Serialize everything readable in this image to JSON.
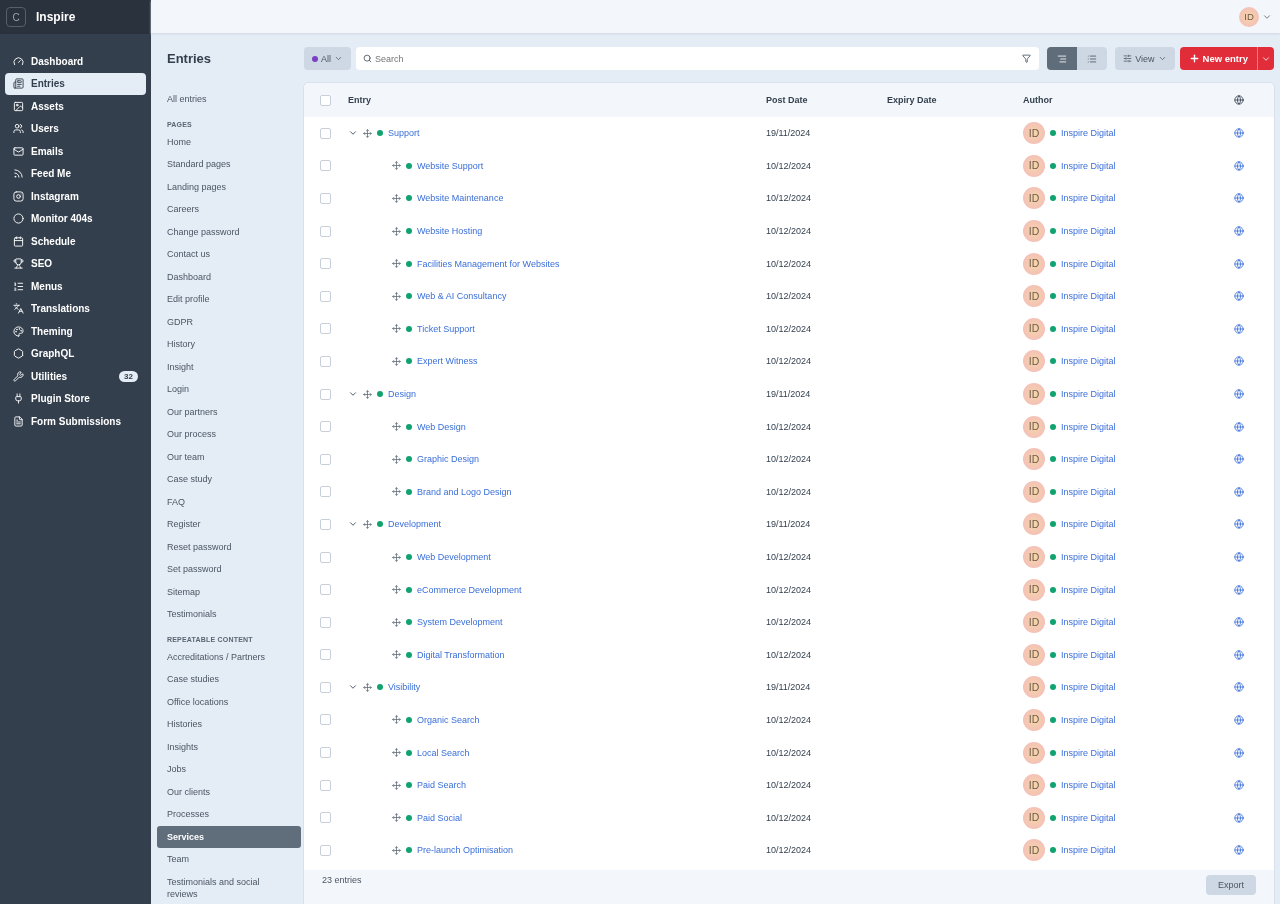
{
  "app": {
    "logo": "C",
    "name": "Inspire"
  },
  "nav": [
    {
      "label": "Dashboard",
      "selected": false
    },
    {
      "label": "Entries",
      "selected": true
    },
    {
      "label": "Assets",
      "selected": false
    },
    {
      "label": "Users",
      "selected": false
    },
    {
      "label": "Emails",
      "selected": false
    },
    {
      "label": "Feed Me",
      "selected": false
    },
    {
      "label": "Instagram",
      "selected": false
    },
    {
      "label": "Monitor 404s",
      "selected": false
    },
    {
      "label": "Schedule",
      "selected": false
    },
    {
      "label": "SEO",
      "selected": false
    },
    {
      "label": "Menus",
      "selected": false
    },
    {
      "label": "Translations",
      "selected": false
    },
    {
      "label": "Theming",
      "selected": false
    },
    {
      "label": "GraphQL",
      "selected": false
    },
    {
      "label": "Utilities",
      "selected": false,
      "badge": "32"
    },
    {
      "label": "Plugin Store",
      "selected": false
    },
    {
      "label": "Form Submissions",
      "selected": false
    }
  ],
  "user_avatar": "ID",
  "sources": {
    "title": "Entries",
    "groups": [
      {
        "items": [
          {
            "label": "All entries",
            "selected": false
          }
        ]
      },
      {
        "heading": "PAGES",
        "items": [
          {
            "label": "Home",
            "selected": false
          },
          {
            "label": "Standard pages",
            "selected": false
          },
          {
            "label": "Landing pages",
            "selected": false
          },
          {
            "label": "Careers",
            "selected": false
          },
          {
            "label": "Change password",
            "selected": false
          },
          {
            "label": "Contact us",
            "selected": false
          },
          {
            "label": "Dashboard",
            "selected": false
          },
          {
            "label": "Edit profile",
            "selected": false
          },
          {
            "label": "GDPR",
            "selected": false
          },
          {
            "label": "History",
            "selected": false
          },
          {
            "label": "Insight",
            "selected": false
          },
          {
            "label": "Login",
            "selected": false
          },
          {
            "label": "Our partners",
            "selected": false
          },
          {
            "label": "Our process",
            "selected": false
          },
          {
            "label": "Our team",
            "selected": false
          },
          {
            "label": "Case study",
            "selected": false
          },
          {
            "label": "FAQ",
            "selected": false
          },
          {
            "label": "Register",
            "selected": false
          },
          {
            "label": "Reset password",
            "selected": false
          },
          {
            "label": "Set password",
            "selected": false
          },
          {
            "label": "Sitemap",
            "selected": false
          },
          {
            "label": "Testimonials",
            "selected": false
          }
        ]
      },
      {
        "heading": "REPEATABLE CONTENT",
        "items": [
          {
            "label": "Accreditations / Partners",
            "selected": false
          },
          {
            "label": "Case studies",
            "selected": false
          },
          {
            "label": "Office locations",
            "selected": false
          },
          {
            "label": "Histories",
            "selected": false
          },
          {
            "label": "Insights",
            "selected": false
          },
          {
            "label": "Jobs",
            "selected": false
          },
          {
            "label": "Our clients",
            "selected": false
          },
          {
            "label": "Processes",
            "selected": false
          },
          {
            "label": "Services",
            "selected": true
          },
          {
            "label": "Team",
            "selected": false
          },
          {
            "label": "Testimonials and social reviews",
            "selected": false
          }
        ]
      }
    ]
  },
  "toolbar": {
    "status_filter": "All",
    "search": {
      "placeholder": "Search"
    },
    "view_modes": [
      {
        "selected": true
      },
      {
        "selected": false
      }
    ],
    "view_button": "View",
    "new_entry": "New entry"
  },
  "table": {
    "select_all_checked": false,
    "columns": [
      "Entry",
      "Post Date",
      "Expiry Date",
      "Author"
    ],
    "rows": [
      {
        "checked": false,
        "title": "Support",
        "post_date": "19/11/2024",
        "author_avatar": "ID",
        "author": "Inspire Digital",
        "expanded": true,
        "children": [
          {
            "checked": false,
            "title": "Website Support",
            "post_date": "10/12/2024",
            "author_avatar": "ID",
            "author": "Inspire Digital"
          },
          {
            "checked": false,
            "title": "Website Maintenance",
            "post_date": "10/12/2024",
            "author_avatar": "ID",
            "author": "Inspire Digital"
          },
          {
            "checked": false,
            "title": "Website Hosting",
            "post_date": "10/12/2024",
            "author_avatar": "ID",
            "author": "Inspire Digital"
          },
          {
            "checked": false,
            "title": "Facilities Management for Websites",
            "post_date": "10/12/2024",
            "author_avatar": "ID",
            "author": "Inspire Digital"
          },
          {
            "checked": false,
            "title": "Web & AI Consultancy",
            "post_date": "10/12/2024",
            "author_avatar": "ID",
            "author": "Inspire Digital"
          },
          {
            "checked": false,
            "title": "Ticket Support",
            "post_date": "10/12/2024",
            "author_avatar": "ID",
            "author": "Inspire Digital"
          },
          {
            "checked": false,
            "title": "Expert Witness",
            "post_date": "10/12/2024",
            "author_avatar": "ID",
            "author": "Inspire Digital"
          }
        ]
      },
      {
        "checked": false,
        "title": "Design",
        "post_date": "19/11/2024",
        "author_avatar": "ID",
        "author": "Inspire Digital",
        "expanded": true,
        "children": [
          {
            "checked": false,
            "title": "Web Design",
            "post_date": "10/12/2024",
            "author_avatar": "ID",
            "author": "Inspire Digital"
          },
          {
            "checked": false,
            "title": "Graphic Design",
            "post_date": "10/12/2024",
            "author_avatar": "ID",
            "author": "Inspire Digital"
          },
          {
            "checked": false,
            "title": "Brand and Logo Design",
            "post_date": "10/12/2024",
            "author_avatar": "ID",
            "author": "Inspire Digital"
          }
        ]
      },
      {
        "checked": false,
        "title": "Development",
        "post_date": "19/11/2024",
        "author_avatar": "ID",
        "author": "Inspire Digital",
        "expanded": true,
        "children": [
          {
            "checked": false,
            "title": "Web Development",
            "post_date": "10/12/2024",
            "author_avatar": "ID",
            "author": "Inspire Digital"
          },
          {
            "checked": false,
            "title": "eCommerce Development",
            "post_date": "10/12/2024",
            "author_avatar": "ID",
            "author": "Inspire Digital"
          },
          {
            "checked": false,
            "title": "System Development",
            "post_date": "10/12/2024",
            "author_avatar": "ID",
            "author": "Inspire Digital"
          },
          {
            "checked": false,
            "title": "Digital Transformation",
            "post_date": "10/12/2024",
            "author_avatar": "ID",
            "author": "Inspire Digital"
          }
        ]
      },
      {
        "checked": false,
        "title": "Visibility",
        "post_date": "19/11/2024",
        "author_avatar": "ID",
        "author": "Inspire Digital",
        "expanded": true,
        "children": [
          {
            "checked": false,
            "title": "Organic Search",
            "post_date": "10/12/2024",
            "author_avatar": "ID",
            "author": "Inspire Digital"
          },
          {
            "checked": false,
            "title": "Local Search",
            "post_date": "10/12/2024",
            "author_avatar": "ID",
            "author": "Inspire Digital"
          },
          {
            "checked": false,
            "title": "Paid Search",
            "post_date": "10/12/2024",
            "author_avatar": "ID",
            "author": "Inspire Digital"
          },
          {
            "checked": false,
            "title": "Paid Social",
            "post_date": "10/12/2024",
            "author_avatar": "ID",
            "author": "Inspire Digital"
          },
          {
            "checked": false,
            "title": "Pre-launch Optimisation",
            "post_date": "10/12/2024",
            "author_avatar": "ID",
            "author": "Inspire Digital"
          }
        ]
      }
    ]
  },
  "footer": {
    "count": "23 entries",
    "export": "Export"
  }
}
